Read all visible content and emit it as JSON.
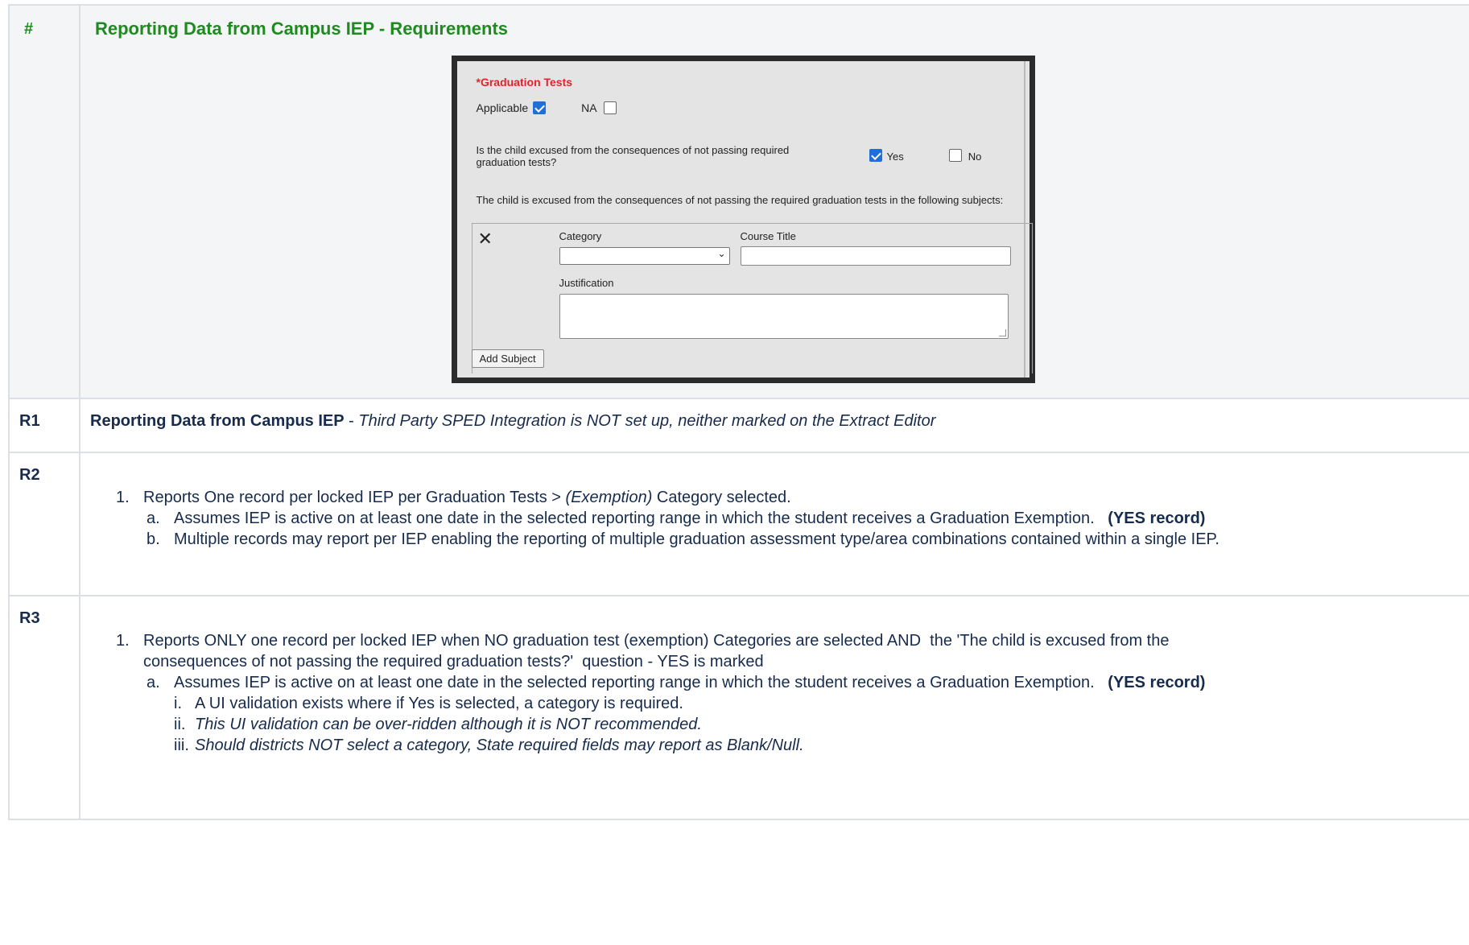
{
  "table": {
    "header": {
      "num": "#",
      "title": "Reporting Data from Campus IEP - Requirements"
    },
    "screenshot": {
      "title": "*Graduation Tests",
      "applicable_label": "Applicable",
      "na_label": "NA",
      "question": "Is the child excused from the consequences of not passing required graduation tests?",
      "yes_label": "Yes",
      "no_label": "No",
      "subjects_text": "The child is excused from the consequences of not passing the required graduation tests in the following subjects:",
      "category_label": "Category",
      "course_title_label": "Course Title",
      "justification_label": "Justification",
      "add_subject": "Add Subject",
      "applicable_checked": true,
      "na_checked": false,
      "yes_checked": true,
      "no_checked": false
    },
    "r1": {
      "num": "R1",
      "bold": "Reporting Data from Campus IEP",
      "sep": " - ",
      "italic": "Third Party SPED Integration is NOT set up, neither marked on the Extract Editor"
    },
    "r2": {
      "num": "R2",
      "item1_marker": "1.",
      "item1_pre": "Reports One record per locked IEP per Graduation Tests > ",
      "item1_italic": "(Exemption)",
      "item1_post": " Category selected.",
      "a_marker": "a.",
      "a_text": "Assumes IEP is active on at least one date in the selected reporting range in which the student receives a Graduation Exemption.",
      "a_bold": "(YES record)",
      "b_marker": "b.",
      "b_text": "Multiple records may report per IEP enabling the reporting of multiple graduation assessment type/area combinations contained within a single IEP."
    },
    "r3": {
      "num": "R3",
      "item1_marker": "1.",
      "item1_text": "Reports ONLY one record per locked IEP when NO graduation test (exemption) Categories are selected AND  the 'The child is excused from the consequences of not passing the required graduation tests?'  question - YES is marked",
      "a_marker": "a.",
      "a_text": "Assumes IEP is active on at least one date in the selected reporting range in which the student receives a Graduation Exemption.",
      "a_bold": "(YES record)",
      "i_marker": "i.",
      "i_text": "A UI validation exists where if Yes is selected, a category is required.",
      "ii_marker": "ii.",
      "ii_text": "This UI validation can be over-ridden although it is NOT recommended.",
      "iii_marker": "iii.",
      "iii_text": "Should districts NOT select a category, State required fields may report as Blank/Null."
    }
  }
}
